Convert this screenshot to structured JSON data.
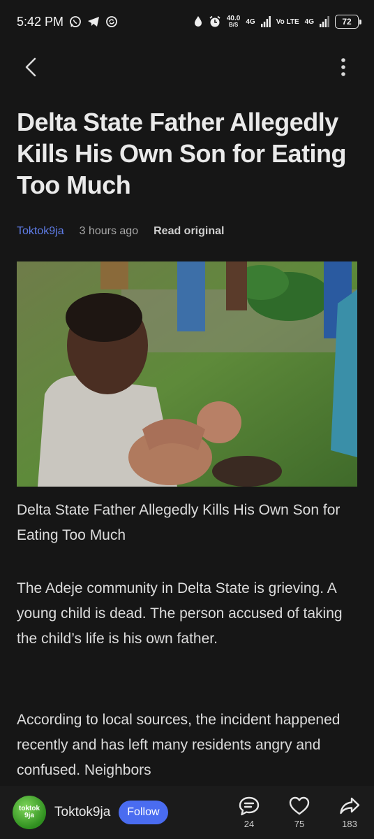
{
  "status_bar": {
    "time": "5:42 PM",
    "left_icons": [
      "whatsapp-icon",
      "telegram-icon",
      "sync-icon"
    ],
    "net_speed_value": "40.0",
    "net_speed_unit": "B/S",
    "network_1": "4G",
    "volte": "Vo LTE",
    "network_2": "4G",
    "battery": "72"
  },
  "nav": {
    "back_icon": "chevron-left-icon",
    "menu_icon": "more-vertical-icon"
  },
  "article": {
    "title": "Delta State Father Allegedly Kills His Own Son for Eating Too Much",
    "source": "Toktok9ja",
    "time_ago": "3 hours ago",
    "read_original": "Read original",
    "image_caption": "Delta State Father Allegedly Kills His Own Son for Eating Too Much",
    "paragraphs": [
      "The Adeje community in Delta State is grieving. A young child is dead. The person accused of taking the child’s life is his own father.",
      "According to local sources, the incident happened recently and has left many residents angry and confused. Neighbors"
    ]
  },
  "bottom_bar": {
    "avatar_text_1": "toktok",
    "avatar_text_2": "9ja",
    "author": "Toktok9ja",
    "follow_label": "Follow",
    "comments_count": "24",
    "likes_count": "75",
    "shares_count": "183"
  },
  "colors": {
    "background": "#161616",
    "accent": "#4a6cf0",
    "source_link": "#5f7de8",
    "text": "#e8e8e8"
  }
}
